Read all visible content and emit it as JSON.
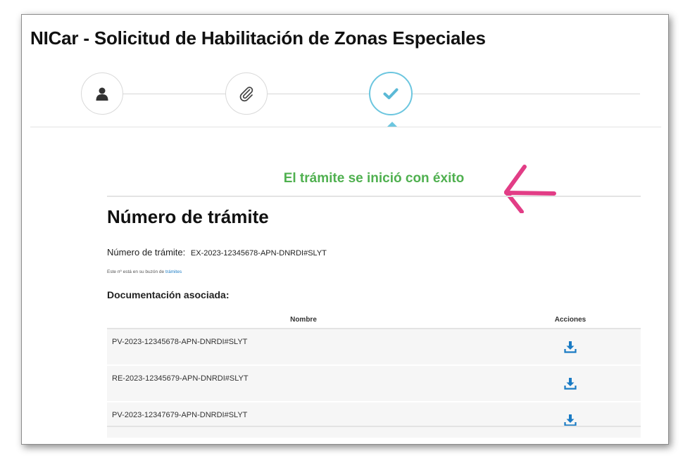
{
  "page": {
    "title": "NICar - Solicitud de Habilitación de Zonas Especiales"
  },
  "stepper": {
    "steps": [
      {
        "icon": "user-icon",
        "state": "done"
      },
      {
        "icon": "paperclip-icon",
        "state": "done"
      },
      {
        "icon": "check-icon",
        "state": "active"
      }
    ],
    "active_color": "#6cc6df"
  },
  "main": {
    "success_message": "El trámite se inició con éxito",
    "success_color": "#4fb04f",
    "annotation_color": "#e23d86",
    "section_title": "Número de trámite",
    "tramite_label": "Número de trámite:",
    "tramite_value": "EX-2023-12345678-APN-DNRDI#SLYT",
    "note_text": "Este nº está en su buzón de",
    "note_link": "trámites",
    "doc_heading": "Documentación asociada:",
    "table": {
      "columns": [
        "Nombre",
        "Acciones"
      ],
      "rows": [
        {
          "name": "PV-2023-12345678-APN-DNRDI#SLYT",
          "action_icon": "download-icon"
        },
        {
          "name": "RE-2023-12345679-APN-DNRDI#SLYT",
          "action_icon": "download-icon"
        },
        {
          "name": "PV-2023-12347679-APN-DNRDI#SLYT",
          "action_icon": "download-icon"
        }
      ]
    },
    "download_color": "#1a7bc4"
  }
}
